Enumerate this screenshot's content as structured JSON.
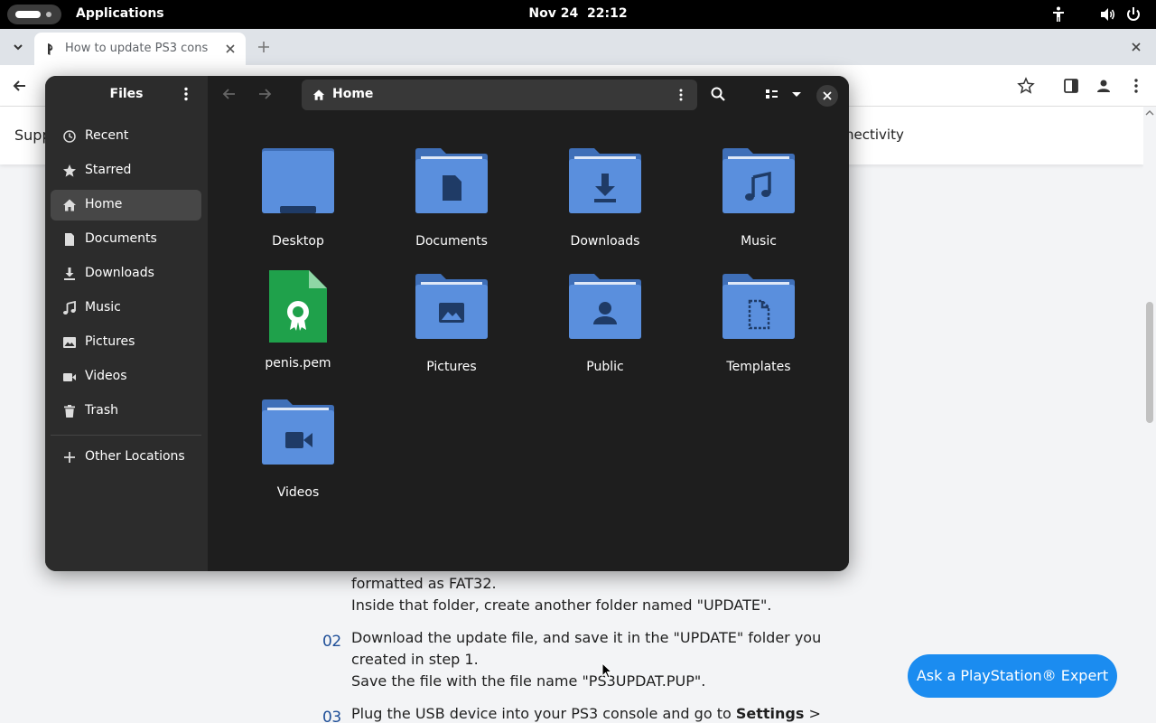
{
  "topbar": {
    "apps_label": "Applications",
    "date": "Nov 24",
    "time": "22:12",
    "tray_icons": [
      "accessibility-icon",
      "volume-icon",
      "power-icon"
    ]
  },
  "browser": {
    "tab_title": "How to update PS3 cons",
    "toolbar_icons": [
      "star-icon",
      "sidebar-icon",
      "profile-icon",
      "more-icon"
    ]
  },
  "webpage": {
    "nav": {
      "support": "Supp",
      "connectivity": "nectivity"
    },
    "step_fragment": "formatted as FAT32.",
    "step_fragment_2": "Inside that folder, create another folder named \"UPDATE\".",
    "steps": [
      {
        "num": "02",
        "lines": [
          "Download the update file, and save it in the \"UPDATE\" folder you",
          "created in step 1.",
          "Save the file with the file name \"PS3UPDAT.PUP\"."
        ]
      },
      {
        "num": "03",
        "line_prefix": "Plug the USB device into your PS3 console and go to ",
        "line_bold": "Settings",
        "line_suffix": " >"
      }
    ],
    "expert_button": "Ask a PlayStation® Expert"
  },
  "files": {
    "title": "Files",
    "sidebar": [
      {
        "label": "Recent",
        "icon": "clock-icon"
      },
      {
        "label": "Starred",
        "icon": "star-icon"
      },
      {
        "label": "Home",
        "icon": "home-icon",
        "active": true
      },
      {
        "label": "Documents",
        "icon": "document-icon"
      },
      {
        "label": "Downloads",
        "icon": "download-icon"
      },
      {
        "label": "Music",
        "icon": "music-icon"
      },
      {
        "label": "Pictures",
        "icon": "picture-icon"
      },
      {
        "label": "Videos",
        "icon": "video-icon"
      },
      {
        "label": "Trash",
        "icon": "trash-icon"
      }
    ],
    "other_locations": "Other Locations",
    "path": "Home",
    "items": [
      {
        "name": "Desktop",
        "icon": "desktop-folder-icon"
      },
      {
        "name": "Documents",
        "icon": "documents-folder-icon"
      },
      {
        "name": "Downloads",
        "icon": "downloads-folder-icon"
      },
      {
        "name": "Music",
        "icon": "music-folder-icon"
      },
      {
        "name": "penis.pem",
        "icon": "certificate-file-icon"
      },
      {
        "name": "Pictures",
        "icon": "pictures-folder-icon"
      },
      {
        "name": "Public",
        "icon": "public-folder-icon"
      },
      {
        "name": "Templates",
        "icon": "templates-folder-icon"
      },
      {
        "name": "Videos",
        "icon": "videos-folder-icon"
      }
    ]
  },
  "colors": {
    "folder_body": "#5a8fdd",
    "folder_tab": "#3f6fb8",
    "folder_glyph": "#1f3b66",
    "cert_green": "#1fa14b",
    "accent_blue": "#1b8cf0"
  }
}
